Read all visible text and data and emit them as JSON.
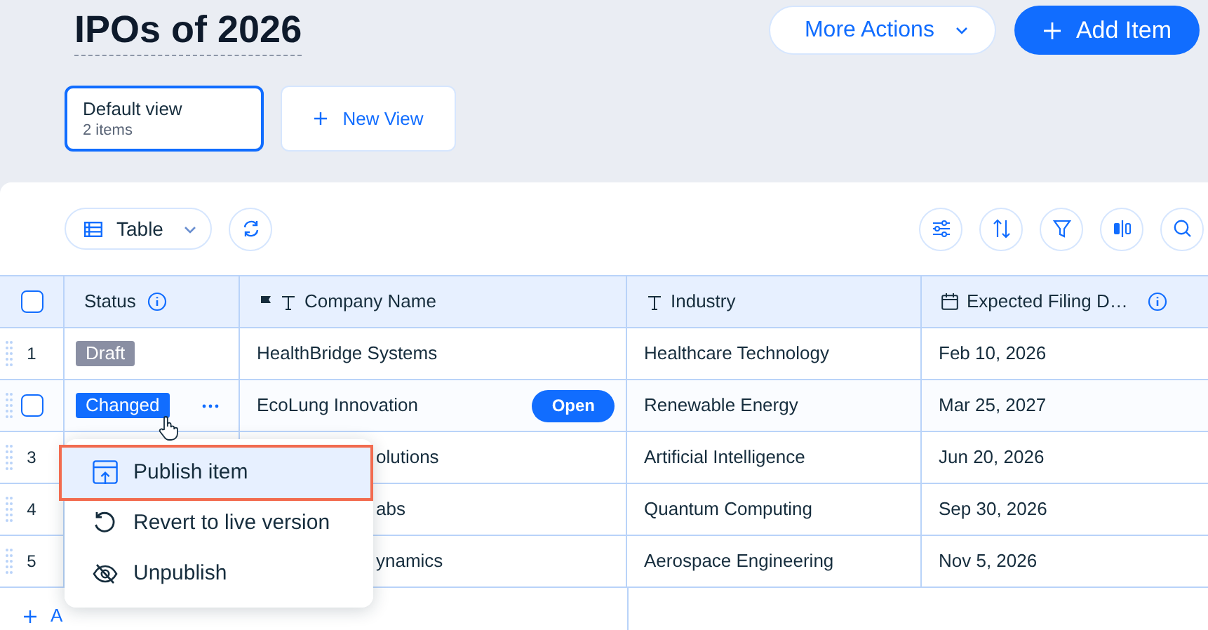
{
  "page": {
    "title": "IPOs of 2026"
  },
  "header_buttons": [
    {
      "label": "More Actions",
      "kind": "dropdown"
    },
    {
      "label": "Add Item",
      "kind": "primary"
    }
  ],
  "views": [
    {
      "label": "Default view",
      "count": "2 items",
      "selected": true
    }
  ],
  "new_view": {
    "label": "New View"
  },
  "toolbar": {
    "view_selector": "Table"
  },
  "table": {
    "select_all": {
      "checked": false
    },
    "columns": [
      {
        "label": "Status",
        "kind": "status"
      },
      {
        "label": "Company Name",
        "kind": "title"
      },
      {
        "label": "Industry",
        "kind": "text"
      },
      {
        "label": "Expected Filing D…",
        "kind": "date"
      }
    ],
    "rows": [
      {
        "number": "1",
        "status": {
          "label": "Draft",
          "kind": "draft"
        },
        "company": "HealthBridge Systems",
        "industry": "Healthcare Technology",
        "date": "Feb 10, 2026",
        "hovered": false
      },
      {
        "status": {
          "label": "Changed",
          "kind": "changed"
        },
        "company": "EcoLung Innovation",
        "open_button": "Open",
        "industry": "Renewable Energy",
        "date": "Mar 25, 2027",
        "hovered": true,
        "checked": false
      },
      {
        "number": "3",
        "company": "olutions",
        "industry": "Artificial Intelligence",
        "date": "Jun 20, 2026",
        "hovered": false
      },
      {
        "number": "4",
        "company": "abs",
        "industry": "Quantum Computing",
        "date": "Sep 30, 2026",
        "hovered": false
      },
      {
        "number": "5",
        "company": "ynamics",
        "industry": "Aerospace Engineering",
        "date": "Nov 5, 2026",
        "hovered": false
      }
    ],
    "add_row": {
      "label": "A"
    }
  },
  "context_menu": {
    "items": [
      {
        "label": "Publish item",
        "kind": "publish",
        "selected": true
      },
      {
        "label": "Revert to live version",
        "kind": "revert",
        "selected": false
      },
      {
        "label": "Unpublish",
        "kind": "unpublish",
        "selected": false
      }
    ]
  }
}
